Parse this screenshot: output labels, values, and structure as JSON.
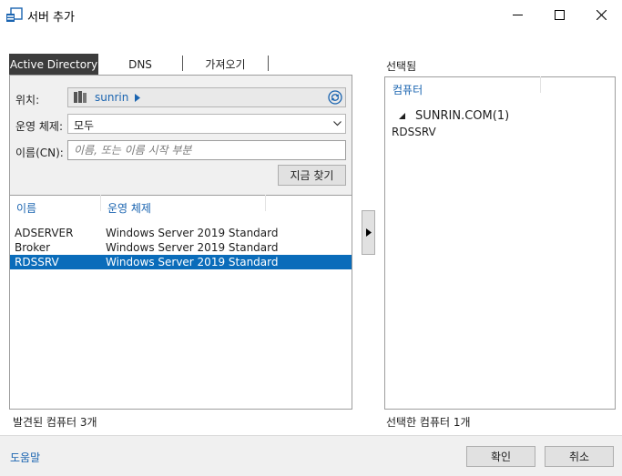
{
  "window": {
    "title": "서버 추가"
  },
  "tabs": [
    {
      "label": "Active Directory",
      "active": true
    },
    {
      "label": "DNS",
      "active": false
    },
    {
      "label": "가져오기",
      "active": false
    }
  ],
  "search": {
    "location_label": "위치:",
    "location_value": "sunrin",
    "os_label": "운영 체제:",
    "os_selected": "모두",
    "name_label": "이름(CN):",
    "name_placeholder": "이름, 또는 이름 시작 부분",
    "find_now_label": "지금 찾기"
  },
  "results": {
    "columns": [
      "이름",
      "운영 체제"
    ],
    "rows": [
      {
        "name": "ADSERVER",
        "os": "Windows Server 2019 Standard",
        "selected": false
      },
      {
        "name": "Broker",
        "os": "Windows Server 2019 Standard",
        "selected": false
      },
      {
        "name": "RDSSRV",
        "os": "Windows Server 2019 Standard",
        "selected": true
      }
    ],
    "status": "발견된 컴퓨터 3개"
  },
  "selected_panel": {
    "heading": "선택됨",
    "column": "컴퓨터",
    "group": "SUNRIN.COM(1)",
    "items": [
      "RDSSRV"
    ],
    "status": "선택한 컴퓨터 1개"
  },
  "footer": {
    "help": "도움말",
    "ok": "확인",
    "cancel": "취소"
  },
  "colors": {
    "accent": "#0a6cba",
    "link": "#1a64b0",
    "tab_active_bg": "#3c3c3c"
  },
  "icons": [
    "server-manager-icon",
    "minimize-icon",
    "maximize-icon",
    "close-icon",
    "server-icon",
    "chevron-right-icon",
    "refresh-icon",
    "chevron-down-icon",
    "add-arrow-icon",
    "collapse-triangle-icon"
  ]
}
